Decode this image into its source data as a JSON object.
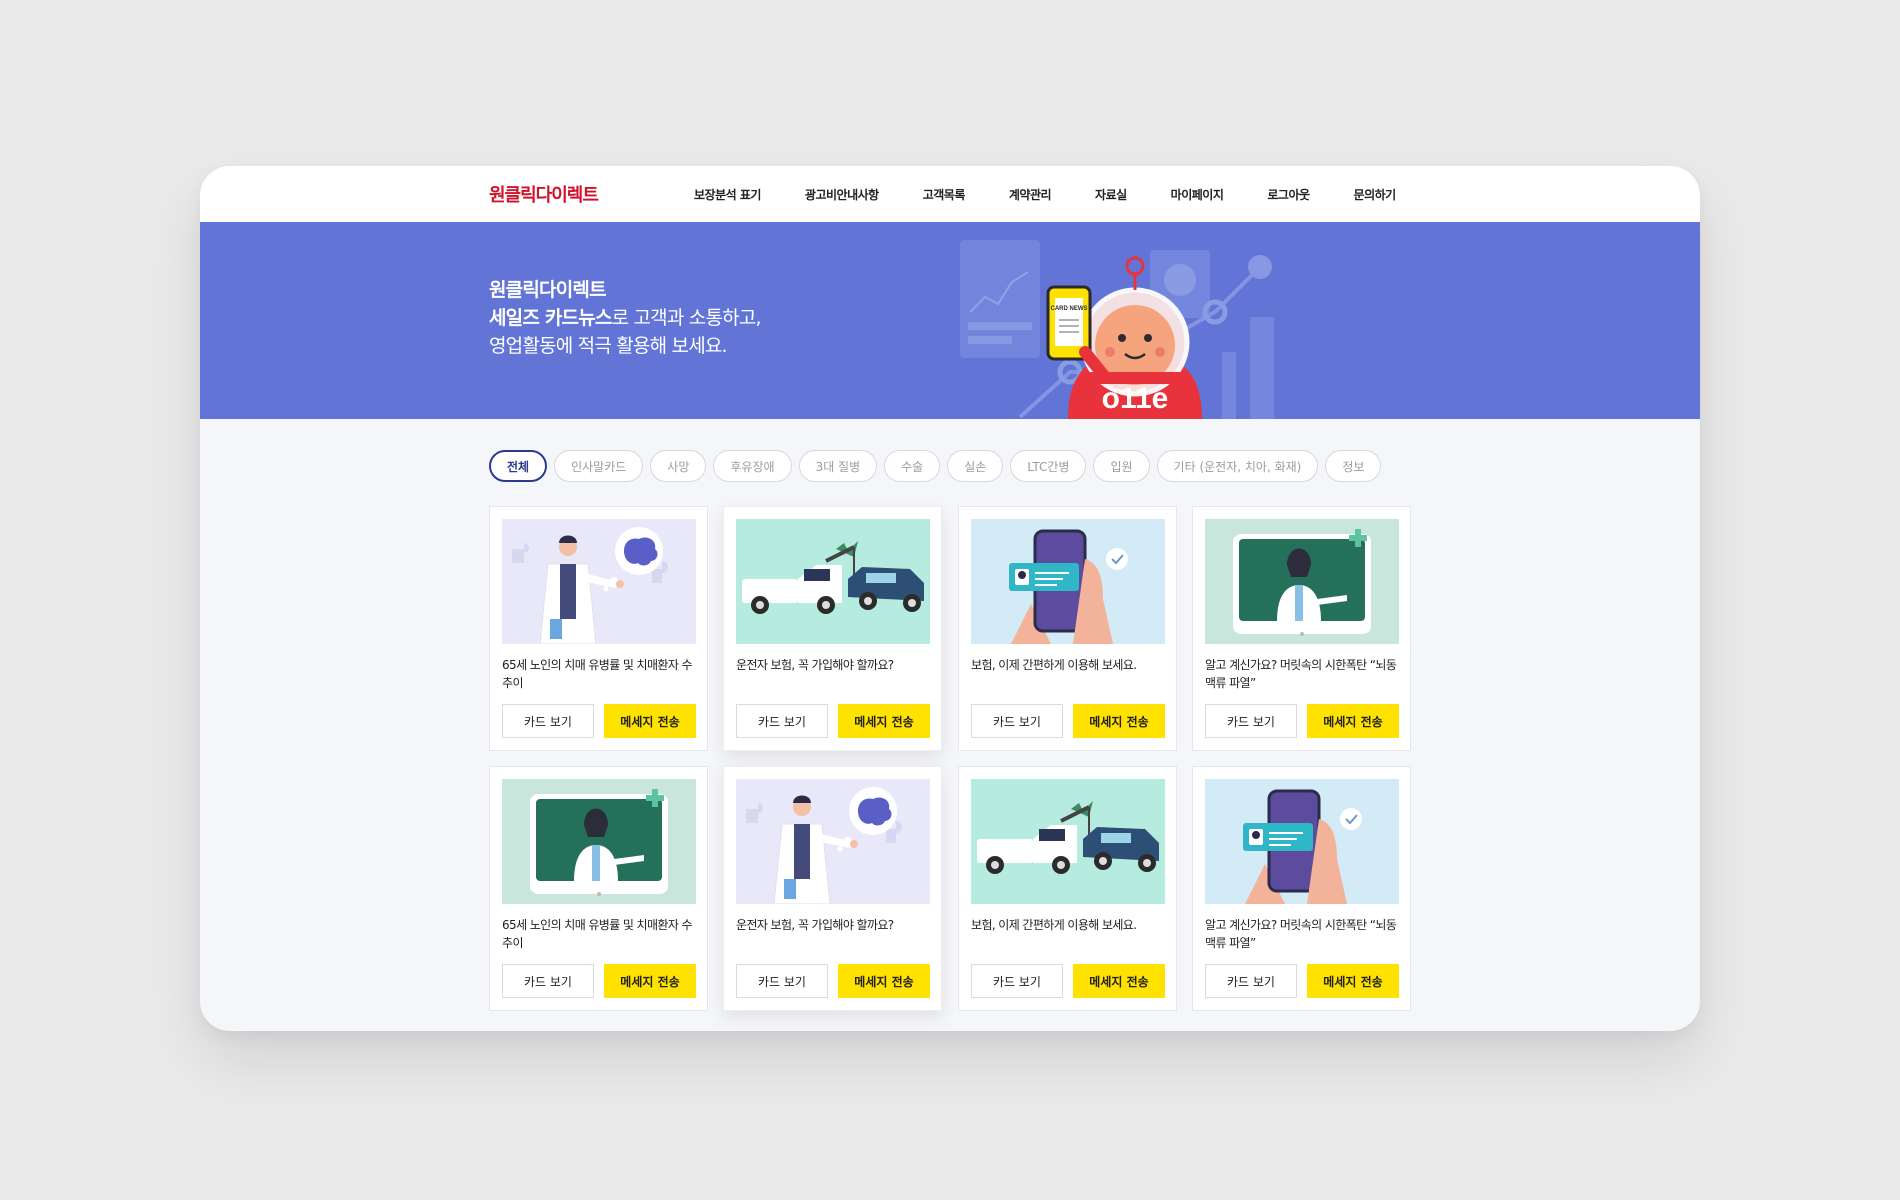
{
  "header": {
    "logo": "원클릭다이렉트",
    "nav": [
      "보장분석 표기",
      "광고비안내사항",
      "고객목록",
      "계약관리",
      "자료실",
      "마이페이지",
      "로그아웃",
      "문의하기"
    ]
  },
  "banner": {
    "line1": "원클릭다이렉트",
    "line2_bold": "세일즈 카드뉴스",
    "line2_rest": "로 고객과 소통하고,",
    "line3": "영업활동에 적극 활용해 보세요.",
    "phone_label": "CARD NEWS",
    "mascot_text": "o11e",
    "accent_color": "#6275d7"
  },
  "filters": {
    "items": [
      "전체",
      "인사말카드",
      "사망",
      "후유장애",
      "3대 질병",
      "수술",
      "실손",
      "LTC간병",
      "입원",
      "기타 (운전자, 치아, 화재)",
      "정보"
    ],
    "active": "전체"
  },
  "buttons": {
    "view": "카드 보기",
    "send": "메세지 전송",
    "send_color": "#ffe200"
  },
  "cards": [
    {
      "title": "65세 노인의 치매 유병률 및 치매환자 수 추이",
      "image": "doctor-brain-illustration"
    },
    {
      "title": "운전자 보험, 꼭 가입해야 할까요?",
      "image": "tow-truck-illustration"
    },
    {
      "title": "보험, 이제 간편하게 이용해 보세요.",
      "image": "phone-id-card-illustration"
    },
    {
      "title": "알고 계신가요? 머릿속의 시한폭탄 “뇌동맥류 파열”",
      "image": "doctor-screen-illustration"
    },
    {
      "title": "65세 노인의 치매 유병률 및 치매환자 수 추이",
      "image": "doctor-screen-illustration"
    },
    {
      "title": "운전자 보험, 꼭 가입해야 할까요?",
      "image": "doctor-brain-illustration"
    },
    {
      "title": "보험, 이제 간편하게 이용해 보세요.",
      "image": "tow-truck-illustration"
    },
    {
      "title": "알고 계신가요? 머릿속의 시한폭탄 “뇌동맥류 파열”",
      "image": "phone-id-card-illustration"
    }
  ]
}
